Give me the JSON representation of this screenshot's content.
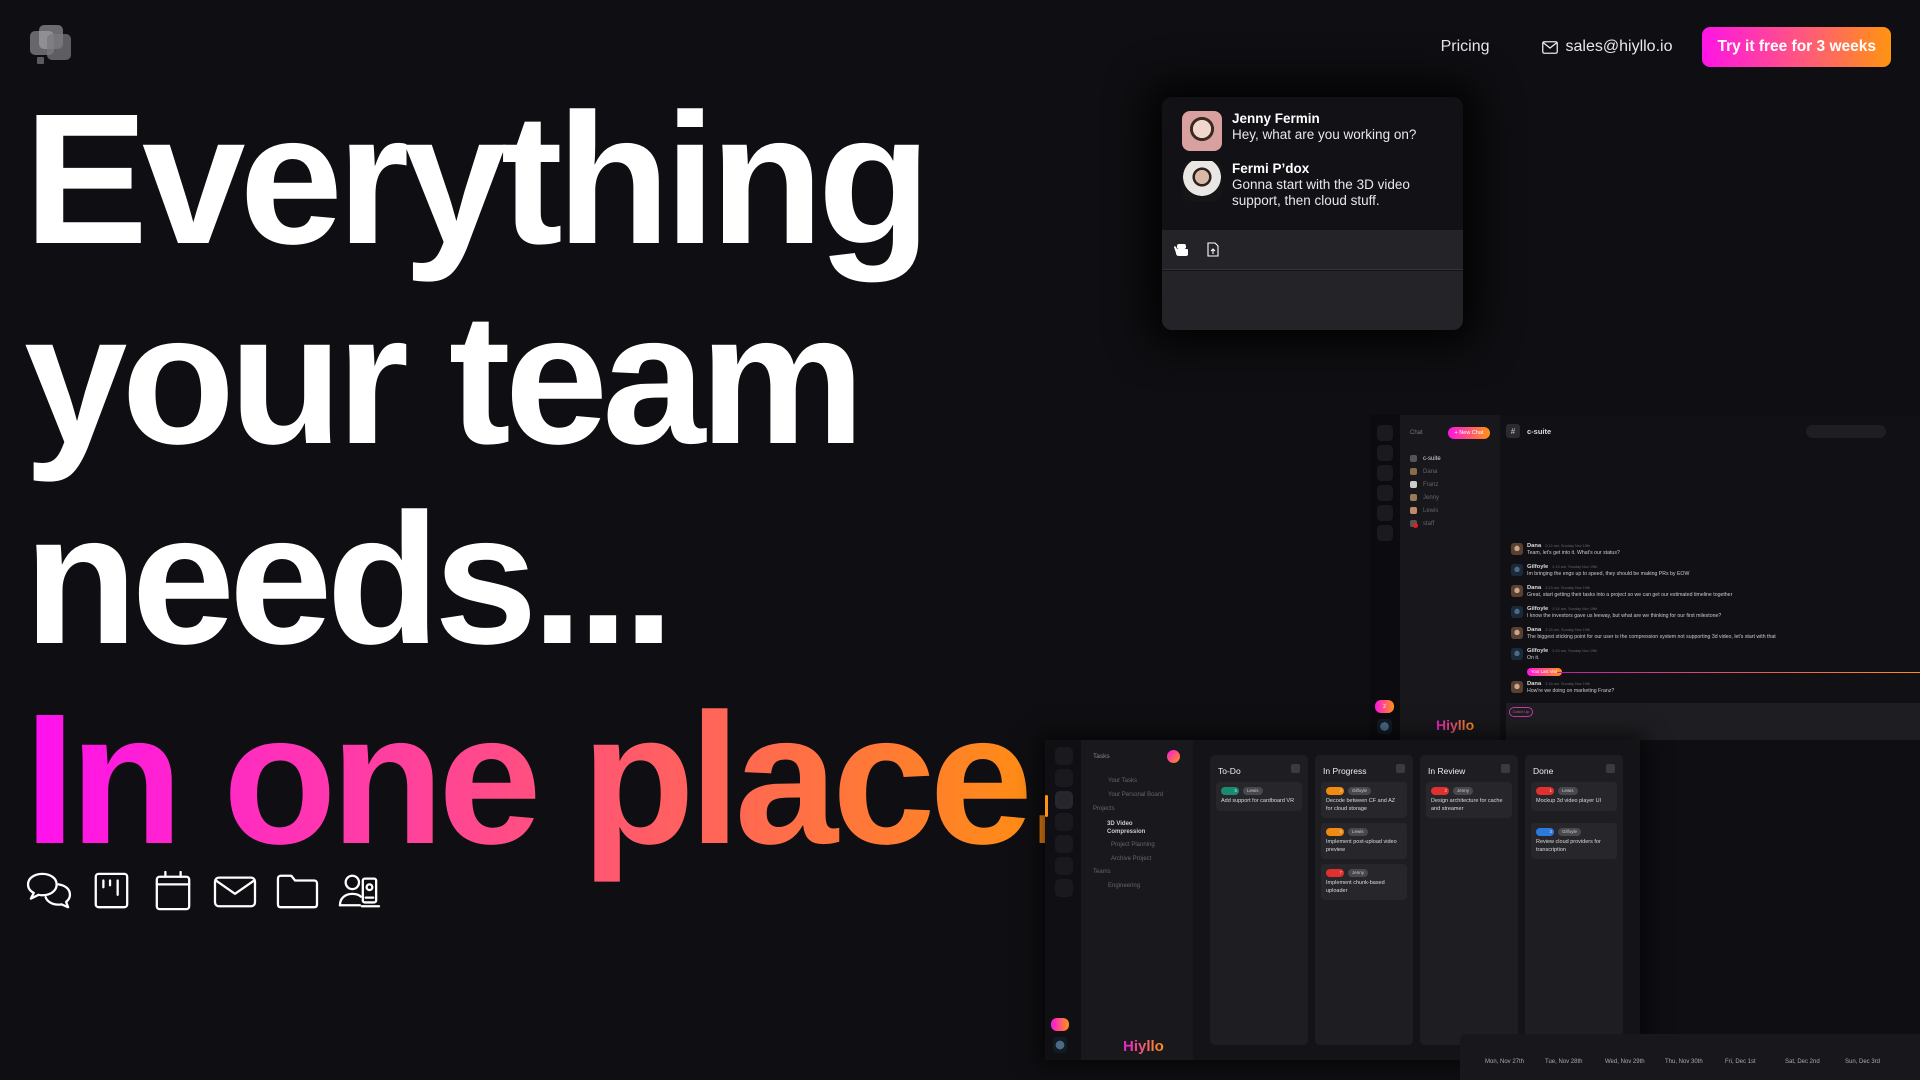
{
  "header": {
    "logo": "hiyllo-logo",
    "nav": {
      "pricing": "Pricing",
      "email": "sales@hiyllo.io",
      "cta": "Try it free for 3 weeks"
    }
  },
  "hero": {
    "lines": [
      "Everything",
      "your team",
      "needs..."
    ],
    "accent": "In one place.",
    "gradient_colors": [
      "#ff10f0",
      "#ff3fa0",
      "#ff6060",
      "#ff920c"
    ]
  },
  "features": [
    {
      "icon": "chat-bubbles-icon",
      "label": "Chat"
    },
    {
      "icon": "kanban-board-icon",
      "label": "Tasks"
    },
    {
      "icon": "calendar-icon",
      "label": "Calendar"
    },
    {
      "icon": "mail-icon",
      "label": "Mail"
    },
    {
      "icon": "folder-icon",
      "label": "Storage"
    },
    {
      "icon": "contacts-icon",
      "label": "Contacts"
    }
  ],
  "chat_card": {
    "messages": [
      {
        "name": "Jenny Fermin",
        "text": "Hey, what are you working on?"
      },
      {
        "name": "Fermi P’dox",
        "text": "Gonna start with the 3D video support, then cloud stuff."
      }
    ]
  },
  "app_chat": {
    "sidebar_title": "Chat",
    "new_chat": "+ New Chat",
    "channels": [
      {
        "name": "c-suite",
        "active": true
      },
      {
        "name": "Dana"
      },
      {
        "name": "Franz"
      },
      {
        "name": "Jenny"
      },
      {
        "name": "Lewis"
      },
      {
        "name": "staff",
        "badge": "2"
      }
    ],
    "channel_title": "c-suite",
    "messages": [
      {
        "author": "Dana",
        "time": "2:12 am, Sunday Nov 19th",
        "text": "Team, let's get into it. What's our status?"
      },
      {
        "author": "Gilfoyle",
        "time": "2:13 am, Sunday Nov 19th",
        "text": "Im bringing the engs up to speed, they should be making PRs by EOW"
      },
      {
        "author": "Dana",
        "time": "2:13 am, Sunday Nov 19th",
        "text": "Great, start getting their tasks into a project so we can get our estimated timeline together"
      },
      {
        "author": "Gilfoyle",
        "time": "2:14 am, Sunday Nov 19th",
        "text": "I know the investors gave us leeway, but what are we thinking for our first milestone?"
      },
      {
        "author": "Dana",
        "time": "2:15 am, Sunday Nov 19th",
        "text": "The biggest sticking point for our user is the compression system not supporting 3d video, let's start with that"
      },
      {
        "author": "Gilfoyle",
        "time": "2:15 am, Sunday Nov 19th",
        "text": "On it."
      }
    ],
    "last_visit_label": "Your Last Visit",
    "after_messages": [
      {
        "author": "Dana",
        "time": "2:16 am, Sunday Nov 19th",
        "text": "How're we doing on marketing Franz?"
      }
    ],
    "catch_up": "Catch Up",
    "brand": "Hiyllo",
    "rail_badge": "2"
  },
  "app_tasks": {
    "sidebar_title": "Tasks",
    "sidebar_items": [
      {
        "label": "Your Tasks"
      },
      {
        "label": "Your Personal Board"
      },
      {
        "label": "Projects",
        "heading": true
      },
      {
        "label": "3D Video Compression",
        "bold": true
      },
      {
        "label": "Project Planning"
      },
      {
        "label": "Archive Project"
      },
      {
        "label": "Teams",
        "heading": true
      },
      {
        "label": "Engineering"
      }
    ],
    "columns": [
      {
        "title": "To-Do",
        "tasks": [
          {
            "priority": "#1a8a70",
            "points": "5",
            "assignee": "Lewis",
            "title": "Add support for cardboard VR"
          }
        ]
      },
      {
        "title": "In Progress",
        "tasks": [
          {
            "priority": "#f08a10",
            "points": "4",
            "assignee": "Gilfoyle",
            "title": "Decode between CF and AZ for cloud storage"
          },
          {
            "priority": "#f08a10",
            "points": "6",
            "assignee": "Lewis",
            "title": "Implement post-upload video preview"
          },
          {
            "priority": "#e03030",
            "points": "7",
            "assignee": "Jenny",
            "title": "Implement chunk-based uploader"
          }
        ]
      },
      {
        "title": "In Review",
        "tasks": [
          {
            "priority": "#e03030",
            "points": "2",
            "assignee": "Jenny",
            "title": "Design architecture for cache and streamer"
          }
        ]
      },
      {
        "title": "Done",
        "tasks": [
          {
            "priority": "#e03030",
            "points": "1",
            "assignee": "Lewis",
            "title": "Mockup 3d video player UI"
          },
          {
            "priority": "#2a7ae0",
            "points": "3",
            "assignee": "Gilfoyle",
            "title": "Review cloud providers for transcription"
          }
        ]
      }
    ],
    "brand": "Hiyllo"
  },
  "app_calendar": {
    "days": [
      "Mon, Nov 27th",
      "Tue, Nov 28th",
      "Wed, Nov 29th",
      "Thu, Nov 30th",
      "Fri, Dec 1st",
      "Sat, Dec 2nd",
      "Sun, Dec 3rd"
    ]
  }
}
